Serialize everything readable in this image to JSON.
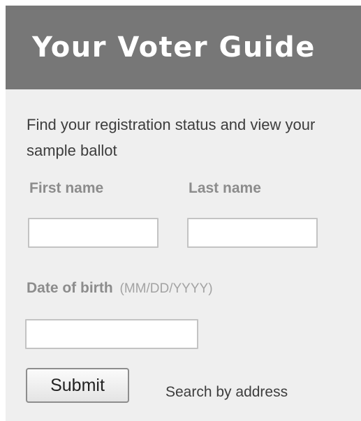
{
  "header": {
    "title": "Your Voter Guide",
    "background_color": "#777777",
    "title_color": "#ffffff"
  },
  "form": {
    "intro": "Find your registration status and view your sample ballot",
    "first_name": {
      "label": "First name",
      "value": "",
      "placeholder": ""
    },
    "last_name": {
      "label": "Last name",
      "value": "",
      "placeholder": ""
    },
    "date_of_birth": {
      "label": "Date of birth",
      "hint": "(MM/DD/YYYY)",
      "value": "",
      "placeholder": ""
    },
    "submit_label": "Submit",
    "search_by_address_label": "Search by address"
  },
  "colors": {
    "panel_background": "#efefef",
    "label_color": "#8c8c8c",
    "text_color": "#3d3d3d"
  }
}
